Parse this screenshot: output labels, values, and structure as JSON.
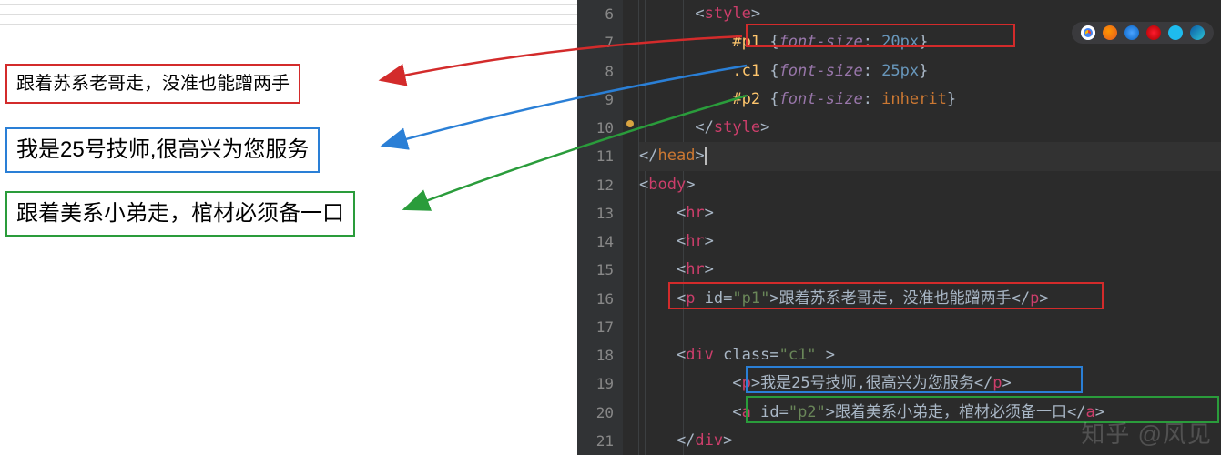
{
  "left": {
    "box_red": "跟着苏系老哥走，没准也能蹭两手",
    "box_blue": "我是25号技师,很高兴为您服务",
    "box_green": "跟着美系小弟走，棺材必须备一口"
  },
  "editor": {
    "line_numbers": [
      "6",
      "7",
      "8",
      "9",
      "10",
      "11",
      "12",
      "13",
      "14",
      "15",
      "16",
      "17",
      "18",
      "19",
      "20",
      "21"
    ],
    "lines": {
      "l6": {
        "pre": "      <",
        "tag": "style",
        "post": ">"
      },
      "l7": {
        "indent": "          ",
        "sel": "#p1 ",
        "lb": "{",
        "prop": "font-size",
        "colon": ": ",
        "val": "20",
        "unit": "px",
        "rb": "}"
      },
      "l8": {
        "indent": "          ",
        "sel": ".c1 ",
        "lb": "{",
        "prop": "font-size",
        "colon": ": ",
        "val": "25",
        "unit": "px",
        "rb": "}"
      },
      "l9": {
        "indent": "          ",
        "sel": "#p2 ",
        "lb": "{",
        "prop": "font-size",
        "colon": ": ",
        "kw": "inherit",
        "rb": "}"
      },
      "l10": {
        "pre": "      </",
        "tag": "style",
        "post": ">"
      },
      "l11": {
        "pre": "</",
        "tag": "head",
        "post": ">"
      },
      "l12": {
        "pre": "<",
        "tag": "body",
        "post": ">"
      },
      "l13": {
        "pre": "    <",
        "tag": "hr",
        "post": ">"
      },
      "l14": {
        "pre": "    <",
        "tag": "hr",
        "post": ">"
      },
      "l15": {
        "pre": "    <",
        "tag": "hr",
        "post": ">"
      },
      "l16": {
        "pre": "    <",
        "tag": "p",
        "sp": " ",
        "attr": "id",
        "eq": "=",
        "str": "\"p1\"",
        "post1": ">",
        "text": "跟着苏系老哥走，没准也能蹭两手",
        "close1": "</",
        "ctag": "p",
        "close2": ">"
      },
      "l17": "",
      "l18": {
        "pre": "    <",
        "tag": "div",
        "sp": " ",
        "attr": "class",
        "eq": "=",
        "str": "\"c1\"",
        "sp2": " ",
        "post1": ">"
      },
      "l19": {
        "pre": "          <",
        "tag": "p",
        "post1": ">",
        "text": "我是25号技师,很高兴为您服务",
        "close1": "</",
        "ctag": "p",
        "close2": ">"
      },
      "l20": {
        "pre": "          <",
        "tag": "a",
        "sp": " ",
        "attr": "id",
        "eq": "=",
        "str": "\"p2\"",
        "post1": ">",
        "text": "跟着美系小弟走，棺材必须备一口",
        "close1": "</",
        "ctag": "a",
        "close2": ">"
      },
      "l21": {
        "pre": "    </",
        "tag": "div",
        "post": ">"
      }
    }
  },
  "watermark": "知乎 @风见",
  "arrows": {
    "red": {
      "color": "#d32b2b"
    },
    "blue": {
      "color": "#2a7fd6"
    },
    "green": {
      "color": "#2a9c3b"
    }
  },
  "browser_icons": [
    "chrome",
    "firefox",
    "safari",
    "opera",
    "ie",
    "edge"
  ]
}
